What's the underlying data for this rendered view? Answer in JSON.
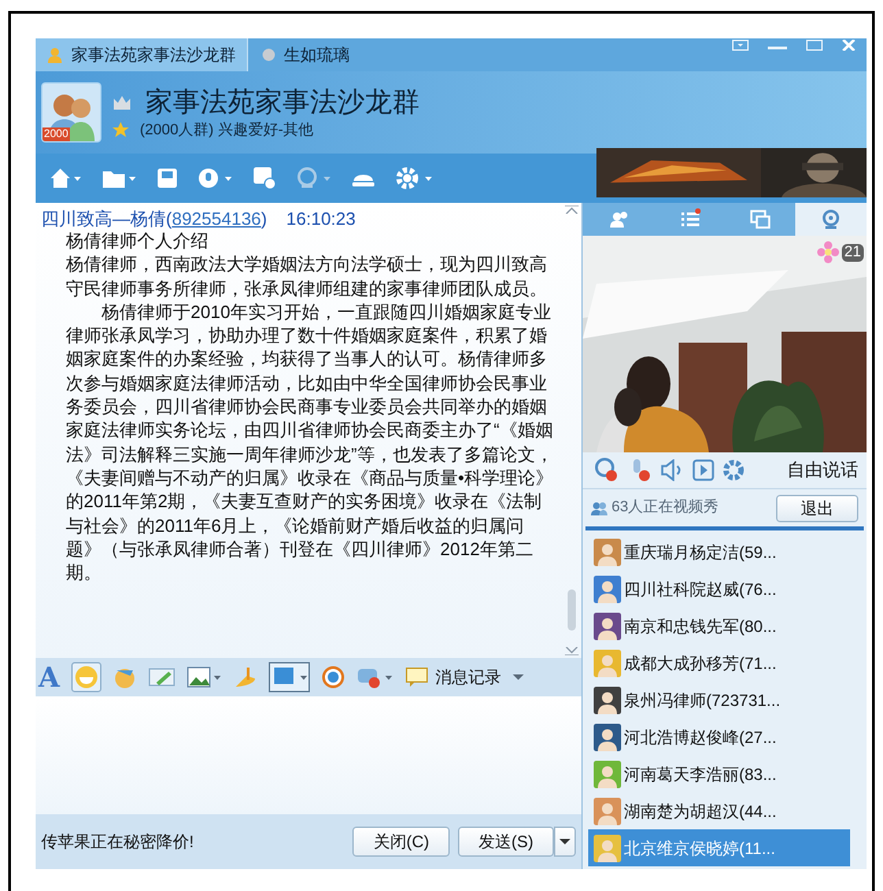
{
  "tabs": [
    {
      "label": "家事法苑家事法沙龙群",
      "selected": true
    },
    {
      "label": "生如琉璃",
      "selected": false
    }
  ],
  "group": {
    "badge": "2000",
    "name": "家事法苑家事法沙龙群",
    "info": "(2000人群) 兴趣爱好-其他"
  },
  "message": {
    "sender": "四川致高—杨倩(",
    "sender_id": "892554136",
    "sender_end": ")",
    "time": "16:10:23",
    "paragraphs": [
      {
        "text": "杨倩律师个人介绍",
        "indent": false
      },
      {
        "text": "杨倩律师，西南政法大学婚姻法方向法学硕士，现为四川致高守民律师事务所律师，张承凤律师组建的家事律师团队成员。",
        "indent": false
      },
      {
        "text": "杨倩律师于2010年实习开始，一直跟随四川婚姻家庭专业律师张承凤学习，协助办理了数十件婚姻家庭案件，积累了婚姻家庭案件的办案经验，均获得了当事人的认可。杨倩律师多次参与婚姻家庭法律师活动，比如由中华全国律师协会民事业务委员会，四川省律师协会民商事专业委员会共同举办的婚姻家庭法律师实务论坛，由四川省律师协会民商委主办了“《婚姻法》司法解释三实施一周年律师沙龙”等，也发表了多篇论文，《夫妻间赠与不动产的归属》收录在《商品与质量•科学理论》的2011年第2期，《夫妻互查财产的实务困境》收录在《法制与社会》的2011年6月上，《论婚前财产婚后收益的归属问题》（与张承凤律师合著）刊登在《四川律师》2012年第二期。",
        "indent": true
      }
    ]
  },
  "input_toolbar": {
    "font_button": "A",
    "history_label": "消息记录"
  },
  "bottom_bar": {
    "ad_text": "传苹果正在秘密降价!",
    "buttons": [
      "关闭(C)",
      "发送(S)"
    ]
  },
  "side_tabs": [
    {
      "kind": "members",
      "selected": false
    },
    {
      "kind": "list",
      "selected": false
    },
    {
      "kind": "windows",
      "selected": false
    },
    {
      "kind": "camera",
      "selected": true
    }
  ],
  "video": {
    "flower_count": "21",
    "speak_mode": "自由说话",
    "viewers": "63人正在视频秀",
    "exit_button": "退出"
  },
  "members": [
    {
      "name": "重庆瑞月杨定洁(59...",
      "color": "#c98a4b",
      "selected": false
    },
    {
      "name": "四川社科院赵威(76...",
      "color": "#3f7fd0",
      "selected": false
    },
    {
      "name": "南京和忠钱先军(80...",
      "color": "#6a4a8c",
      "selected": false
    },
    {
      "name": "成都大成孙移芳(71...",
      "color": "#e8b830",
      "selected": false
    },
    {
      "name": "泉州冯律师(723731...",
      "color": "#404040",
      "selected": false
    },
    {
      "name": "河北浩博赵俊峰(27...",
      "color": "#2d5a8a",
      "selected": false
    },
    {
      "name": "河南葛天李浩丽(83...",
      "color": "#6fb83a",
      "selected": false
    },
    {
      "name": "湖南楚为胡超汉(44...",
      "color": "#d9925a",
      "selected": false
    },
    {
      "name": "北京维京侯晓婷(11...",
      "color": "#e6c040",
      "selected": true
    }
  ]
}
